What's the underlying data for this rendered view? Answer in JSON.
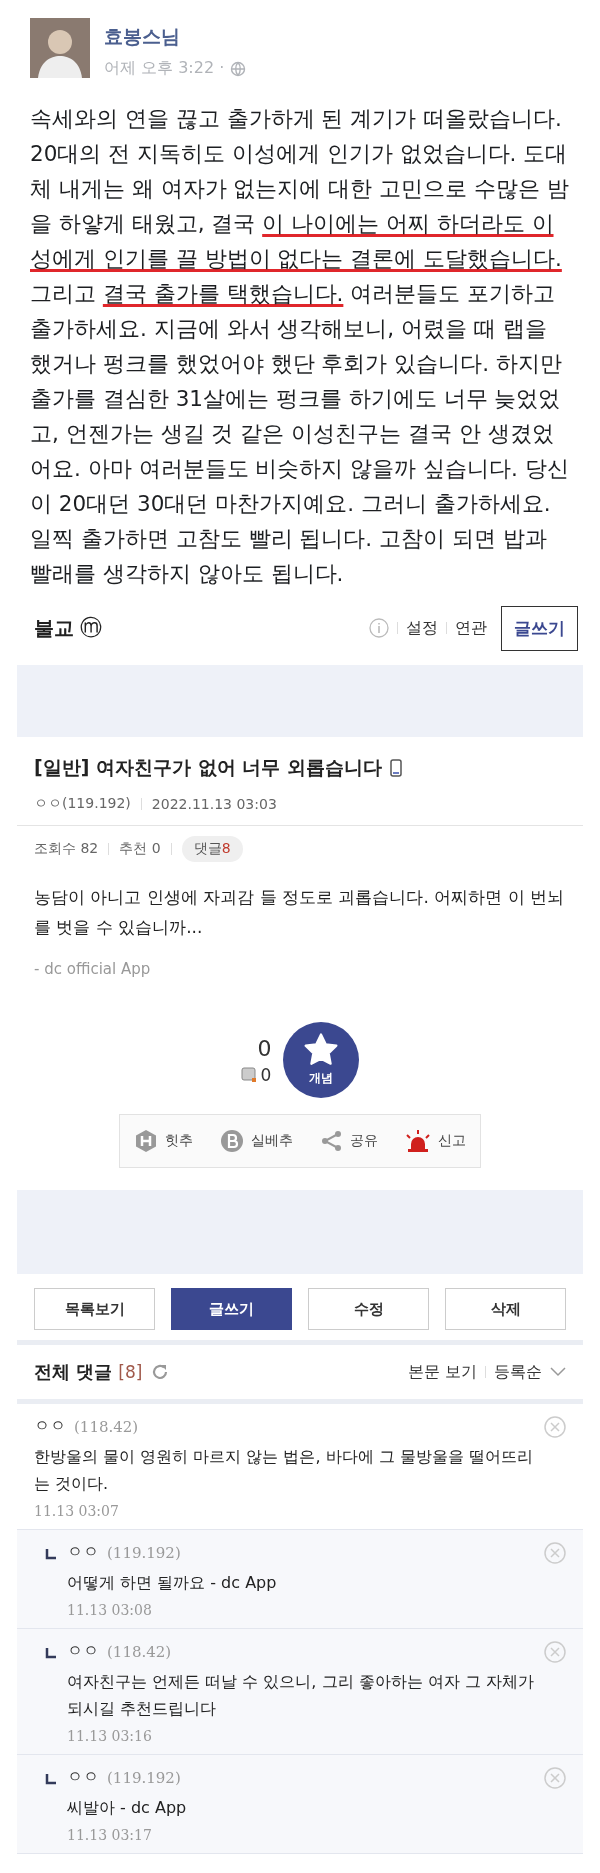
{
  "fb_post": {
    "author": "효봉스님",
    "time": "어제 오후 3:22 ·",
    "body": [
      {
        "text": "속세와의 연을 끊고 출가하게 된 계기가 떠올랐습니다. 20대의 전 지독히도 이성에게 인기가 없었습니다. 도대체 내게는 왜 여자가 없는지에 대한 고민으로 수많은 밤을 하얗게 태웠고, 결국 ",
        "underlined": false
      },
      {
        "text": "이 나이에는 어찌 하더라도 이성에게 인기를 끌 방법이 없다는 결론에 도달했습니다.",
        "underlined": true
      },
      {
        "text": " 그리고 ",
        "underlined": false
      },
      {
        "text": "결국 출가를 택했습니다.",
        "underlined": true
      },
      {
        "text": " 여러분들도 포기하고 출가하세요. 지금에 와서 생각해보니, 어렸을 때 랩을 했거나 펑크를 했었어야 했단 후회가 있습니다. 하지만 출가를 결심한 31살에는 펑크를 하기에도 너무 늦었었고, 언젠가는 생길 것 같은 이성친구는 결국 안 생겼었어요. 아마 여러분들도 비슷하지 않을까 싶습니다. 당신이 20대던 30대던 마찬가지예요. 그러니 출가하세요. 일찍 출가하면 고참도 빨리 됩니다. 고참이 되면 밥과 빨래를 생각하지 않아도 됩니다.",
        "underlined": false
      }
    ]
  },
  "gallery_bar": {
    "name": "불교",
    "badge": "ⓜ",
    "links": [
      "설정",
      "연관"
    ],
    "write_button": "글쓰기"
  },
  "post": {
    "title": "[일반] 여자친구가 없어 너무 외롭습니다",
    "author": "ㅇㅇ(119.192)",
    "date": "2022.11.13 03:03",
    "views": "조회수 82",
    "recommends": "추천 0",
    "comments_label": "댓글",
    "comments_count": "8",
    "body": "농담이 아니고 인생에 자괴감 들 정도로 괴롭습니다. 어찌하면 이 번뇌를 벗을 수 있습니까...",
    "signature": "- dc official App",
    "upvotes": "0",
    "fixed_upvotes": "0",
    "upvote_button": "개념",
    "actions": [
      {
        "kind": "hit",
        "label": "힛추"
      },
      {
        "kind": "best",
        "label": "실베추"
      },
      {
        "kind": "share",
        "label": "공유"
      },
      {
        "kind": "report",
        "label": "신고"
      }
    ]
  },
  "buttons": [
    {
      "label": "목록보기",
      "selected": false
    },
    {
      "label": "글쓰기",
      "selected": true
    },
    {
      "label": "수정",
      "selected": false
    },
    {
      "label": "삭제",
      "selected": false
    }
  ],
  "comments_header": {
    "title": "전체 댓글",
    "count": "[8]",
    "view_body": "본문 보기",
    "sort": "등록순"
  },
  "comments": [
    {
      "reply": false,
      "author": "ㅇㅇ",
      "ip": "(118.42)",
      "text": "한방울의 물이 영원히 마르지 않는 법은, 바다에 그 물방울을 떨어뜨리는 것이다.",
      "time": "11.13 03:07"
    },
    {
      "reply": true,
      "author": "ㅇㅇ",
      "ip": "(119.192)",
      "text": "어떻게 하면 될까요 - dc App",
      "time": "11.13 03:08"
    },
    {
      "reply": true,
      "author": "ㅇㅇ",
      "ip": "(118.42)",
      "text": "여자친구는 언제든 떠날 수 있으니, 그리 좋아하는 여자 그 자체가 되시길 추천드립니다",
      "time": "11.13 03:16"
    },
    {
      "reply": true,
      "author": "ㅇㅇ",
      "ip": "(119.192)",
      "text": "씨발아 - dc App",
      "time": "11.13 03:17"
    }
  ]
}
